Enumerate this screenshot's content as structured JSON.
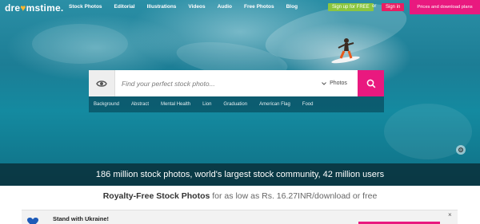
{
  "brand": {
    "logo_before": "dre",
    "logo_o": "a",
    "logo_after": "mstime."
  },
  "nav": {
    "links": [
      "Stock Photos",
      "Editorial",
      "Illustrations",
      "Videos",
      "Audio",
      "Free Photos",
      "Blog"
    ],
    "signup_label": "Sign up for FREE",
    "or_label": "or",
    "signin_label": "Sign in",
    "plans_label": "Prices and download plans"
  },
  "search": {
    "placeholder": "Find your perfect stock photo...",
    "type_selected": "Photos"
  },
  "suggestions": [
    "Background",
    "Abstract",
    "Mental Health",
    "Lion",
    "Graduation",
    "American Flag",
    "Food"
  ],
  "stats": {
    "text": "186 million stock photos, world's largest stock community, 42 million users"
  },
  "tagline": {
    "bold": "Royalty-Free Stock Photos",
    "rest": " for as low as Rs. 16.27INR/download or free"
  },
  "ukraine_banner": {
    "title": "Stand with Ukraine!",
    "close": "×"
  },
  "colors": {
    "accent_pink": "#e9197f",
    "signup_green": "#8cc63f",
    "logo_orange": "#f5b731"
  }
}
